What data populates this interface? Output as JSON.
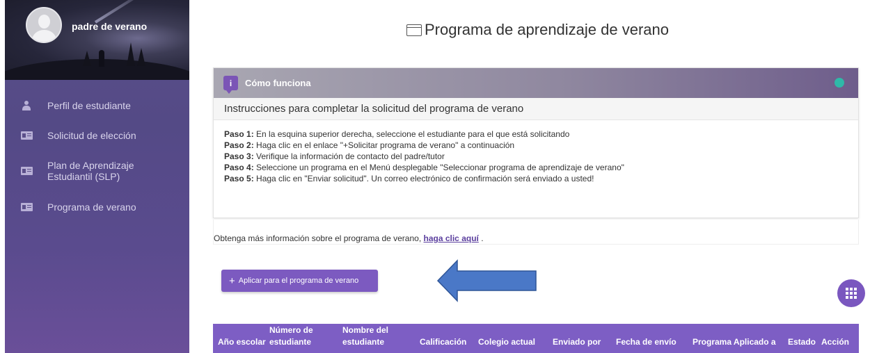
{
  "sidebar": {
    "user_name": "padre de verano",
    "items": [
      {
        "label": "Perfil de estudiante",
        "icon": "person-icon"
      },
      {
        "label": "Solicitud de elección",
        "icon": "id-card-icon"
      },
      {
        "label": "Plan de Aprendizaje Estudiantil (SLP)",
        "icon": "id-card-icon"
      },
      {
        "label": "Programa de verano",
        "icon": "id-card-icon"
      }
    ]
  },
  "main": {
    "title": "Programa de aprendizaje de verano",
    "how_it_works": {
      "title": "Cómo funciona",
      "subtitle": "Instrucciones para completar la solicitud del programa de verano",
      "steps": [
        {
          "label": "Paso 1:",
          "text": " En la esquina superior derecha, seleccione el estudiante para el que está solicitando"
        },
        {
          "label": "Paso 2:",
          "text": " Haga clic en el enlace \"+Solicitar programa de verano\" a continuación"
        },
        {
          "label": "Paso 3:",
          "text": " Verifique la información de contacto del padre/tutor"
        },
        {
          "label": "Paso 4:",
          "text": " Seleccione un programa en el Menú desplegable \"Seleccionar programa de aprendizaje de verano\""
        },
        {
          "label": "Paso 5:",
          "text": " Haga clic en \"Enviar solicitud\". Un correo electrónico de confirmación será enviado a usted!"
        }
      ]
    },
    "more_info": {
      "text": "Obtenga más información sobre el programa de verano, ",
      "link": "haga clic aquí",
      "suffix": " ."
    },
    "apply_button": {
      "plus": "+",
      "label": "Aplicar para el programa de verano"
    },
    "table": {
      "headers": [
        "Año escolar",
        "Número de estudiante",
        "Nombre del estudiante",
        "Calificación",
        "Colegio actual",
        "Enviado por",
        "Fecha de envío",
        "Programa Aplicado a",
        "Estado",
        "Acción"
      ]
    }
  },
  "colors": {
    "accent": "#7c5ac0",
    "sidebar": "#5b4f8a",
    "status": "#2fb9a8",
    "annotation_arrow": "#4a78c7"
  }
}
